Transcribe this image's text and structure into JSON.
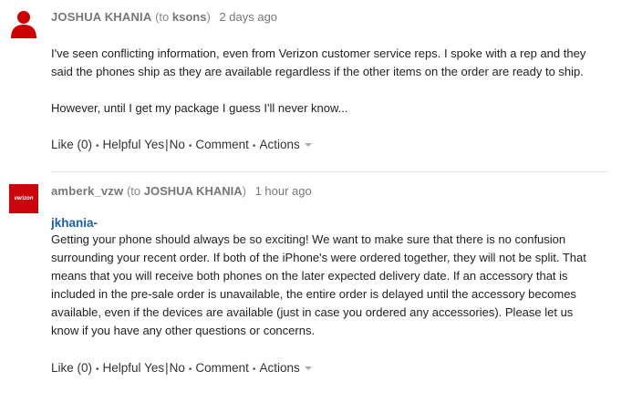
{
  "comments": [
    {
      "author": "JOSHUA KHANIA",
      "to_prefix": "(to ",
      "to_name": "ksons",
      "to_suffix": ")",
      "time": "2 days ago",
      "paragraphs": [
        "I've seen conflicting information, even from Verizon customer service reps. I spoke with a rep and they said the phones ship as they are available regardless if the other items on the order are ready to ship.",
        "However, until I get my package I guess I'll never know..."
      ],
      "actions": {
        "like": "Like (0)",
        "helpful": "Helpful",
        "yes": "Yes",
        "no": "No",
        "comment": "Comment",
        "actions": "Actions"
      }
    },
    {
      "author": "amberk_vzw",
      "to_prefix": "(to ",
      "to_name": "JOSHUA KHANIA",
      "to_suffix": ")",
      "time": "1 hour ago",
      "avatar_text": "verizon",
      "greeting": "jkhania-",
      "body": "Getting your phone should always be so exciting! We want to make sure that there is no confusion surrounding your recent order. If both of the iPhone's were ordered together, they will not be split. That means that you will receive both phones on the later expected delivery date. If an accessory that is included in the pre-sale order is unavailable, the entire order is delayed until the accessory becomes available, even if the devices are available (just in case you ordered any accessories). Please let us know if you have any other questions or concerns.",
      "actions": {
        "like": "Like (0)",
        "helpful": "Helpful",
        "yes": "Yes",
        "no": "No",
        "comment": "Comment",
        "actions": "Actions"
      }
    }
  ],
  "colors": {
    "accent_red": "#cd040b",
    "greeting_blue": "#1a5fb4",
    "avatar_red": "#cc0000"
  },
  "icons": {
    "user_avatar": "person-icon",
    "verizon_avatar": "verizon-logo-icon",
    "menu_caret": "caret-down-icon"
  }
}
